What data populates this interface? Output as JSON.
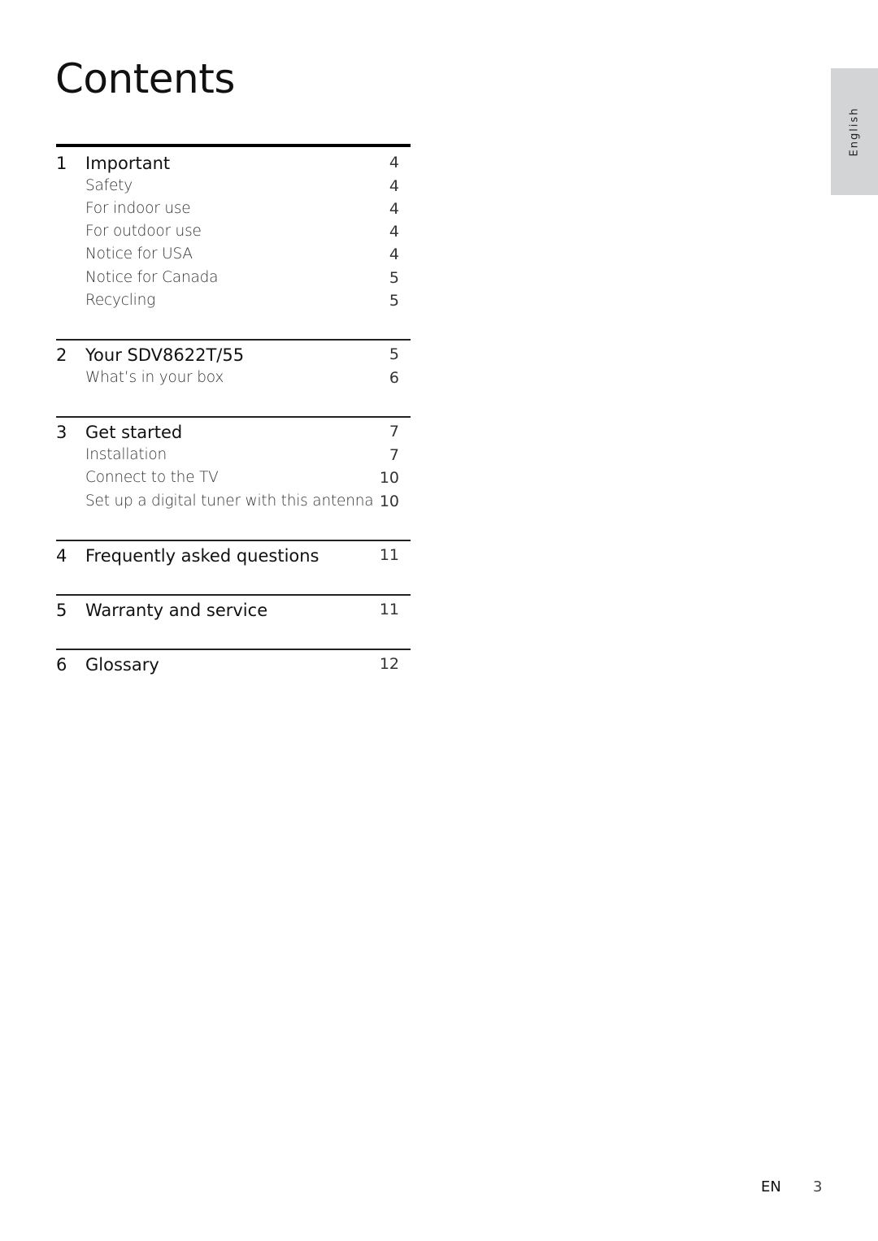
{
  "title": "Contents",
  "language_tab": "English",
  "footer": {
    "lang": "EN",
    "page": "3"
  },
  "sections": [
    {
      "number": "1",
      "title": "Important",
      "page": "4",
      "items": [
        {
          "title": "Safety",
          "page": "4"
        },
        {
          "title": "For indoor use",
          "page": "4"
        },
        {
          "title": "For outdoor use",
          "page": "4"
        },
        {
          "title": "Notice for USA",
          "page": "4"
        },
        {
          "title": "Notice for Canada",
          "page": "5"
        },
        {
          "title": "Recycling",
          "page": "5"
        }
      ]
    },
    {
      "number": "2",
      "title": "Your SDV8622T/55",
      "page": "5",
      "items": [
        {
          "title": "What’s in your box",
          "page": "6"
        }
      ]
    },
    {
      "number": "3",
      "title": "Get started",
      "page": "7",
      "items": [
        {
          "title": "Installation",
          "page": "7"
        },
        {
          "title": "Connect to the TV",
          "page": "10"
        },
        {
          "title": "Set up a digital tuner with this antenna",
          "page": "10"
        }
      ]
    },
    {
      "number": "4",
      "title": "Frequently asked questions",
      "page": "11",
      "items": []
    },
    {
      "number": "5",
      "title": "Warranty and service",
      "page": "11",
      "items": []
    },
    {
      "number": "6",
      "title": "Glossary",
      "page": "12",
      "items": []
    }
  ]
}
